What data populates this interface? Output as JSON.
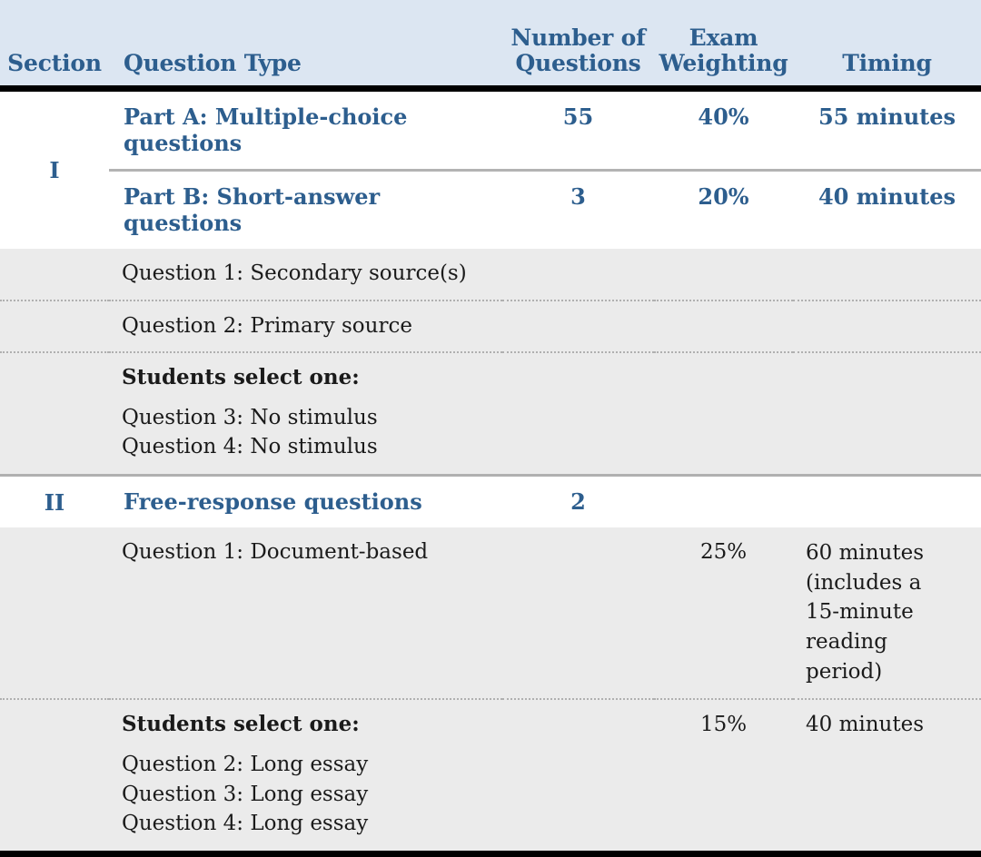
{
  "table": {
    "headers": {
      "section": "Section",
      "question_type": "Question Type",
      "number_of_questions": "Number of\nQuestions",
      "number_of_questions_l1": "Number of",
      "number_of_questions_l2": "Questions",
      "exam_weighting_l1": "Exam",
      "exam_weighting_l2": "Weighting",
      "timing": "Timing"
    },
    "colors": {
      "header_background": "#dce6f2",
      "header_text": "#2d5e8e",
      "accent_blue": "#2d5e8e",
      "gray_row_background": "#ebebeb",
      "white_row_background": "#ffffff",
      "rule_black": "#000000",
      "rule_gray": "#b0b0b0"
    },
    "sections": [
      {
        "numeral": "I",
        "rows": [
          {
            "style": "blue",
            "question_type": "Part A: Multiple-choice questions",
            "number": "55",
            "weighting": "40%",
            "timing": "55 minutes"
          },
          {
            "style": "blue",
            "question_type": "Part B: Short-answer questions",
            "number": "3",
            "weighting": "20%",
            "timing": "40 minutes"
          },
          {
            "style": "gray",
            "question_type": "Question 1: Secondary source(s)",
            "number": "",
            "weighting": "",
            "timing": ""
          },
          {
            "style": "gray",
            "question_type": "Question 2: Primary source",
            "number": "",
            "weighting": "",
            "timing": ""
          },
          {
            "style": "gray",
            "lead": "Students select one:",
            "sub_lines": [
              "Question 3: No stimulus",
              "Question 4: No stimulus"
            ],
            "number": "",
            "weighting": "",
            "timing": ""
          }
        ]
      },
      {
        "numeral": "II",
        "rows": [
          {
            "style": "blue",
            "question_type": "Free-response questions",
            "number": "2",
            "weighting": "",
            "timing": ""
          },
          {
            "style": "gray",
            "question_type": "Question 1: Document-based",
            "number": "",
            "weighting": "25%",
            "timing_lines": [
              "60 minutes",
              "(includes a",
              "15-minute",
              "reading period)"
            ]
          },
          {
            "style": "gray",
            "lead": "Students select one:",
            "sub_lines": [
              "Question 2: Long essay",
              "Question 3: Long essay",
              "Question 4: Long essay"
            ],
            "number": "",
            "weighting": "15%",
            "timing": "40 minutes"
          }
        ]
      }
    ]
  }
}
